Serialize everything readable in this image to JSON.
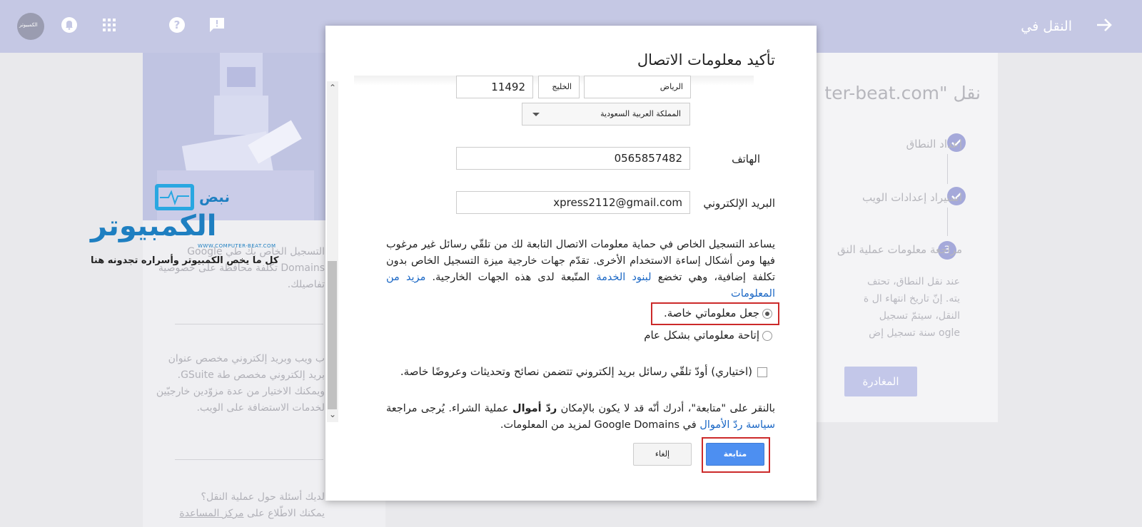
{
  "topbar": {
    "title": "النقل في",
    "avatar_text": "الكمبيوتر"
  },
  "background_left": {
    "text1": "التسجيل الخاص بك طي Google Domains تكلفة محافظة على خصوصية تفاصيلك.",
    "text2": "ب ويب وبريد إلكتروني مخصص عنوان بريد إلكتروني مخصص طة GSuite. ويمكنك الاختيار من عدة مزوّدين خارجيّين لخدمات الاستضافة على الويب.",
    "text3a": "لديك أسئلة حول عملية النقل؟",
    "text3b_prefix": "يمكنك الاطّلاع على",
    "text3b_link": "مركز المساعدة"
  },
  "background_right": {
    "title": "نقل \"ter-beat.com",
    "steps": [
      {
        "label": "إعداد النطاق"
      },
      {
        "label": "استيراد إعدادات الويب"
      },
      {
        "number": "3",
        "label": "مراجعة معلومات عملية النق"
      }
    ],
    "text": "عند نقل النطاق، تحتف يته. إنّ تاريخ انتهاء ال ة النقل، سيتمّ تسجيل ogle سنة تسجيل إض",
    "cancel_button": "المغادرة"
  },
  "watermark": {
    "nabd": "نبض",
    "name": "الكمبيوتر",
    "url": "WWW.COMPUTER-BEAT.COM",
    "subtitle": "كل ما يخص الكمبيوتر وأسراره تجدونه هنا"
  },
  "dialog": {
    "title": "تأكيد معلومات الاتصال",
    "city": "الرياض",
    "region": "الخليج",
    "postal": "11492",
    "country": "المملكة العربية السعودية",
    "phone_label": "الهاتف",
    "phone": "0565857482",
    "email_label": "البريد الإلكتروني",
    "email": "xpress2112@gmail.com",
    "privacy_text": "يساعد التسجيل الخاص في حماية معلومات الاتصال التابعة لك من تلقّي رسائل غير مرغوب فيها ومن أشكال إساءة الاستخدام الأخرى. تقدّم جهات خارجية ميزة التسجيل الخاص بدون تكلفة إضافية، وهي تخضع",
    "terms_link": "لبنود الخدمة",
    "privacy_text2": "المتّبعة لدى هذه الجهات الخارجية.",
    "learn_more": "مزيد من المعلومات",
    "radio_private": "جعل معلوماتي خاصة.",
    "radio_public": "إتاحة معلوماتي بشكل عام",
    "optin": "(اختياري) أودّ تلقّي رسائل بريد إلكتروني تتضمن نصائح وتحديثات وعروضًا خاصة.",
    "refund_text1": "بالنقر على \"متابعة\"، أدرك أنّه قد لا يكون بالإمكان",
    "refund_bold": "ردّ أموال",
    "refund_text2": "عملية الشراء. يُرجى مراجعة",
    "refund_link": "سياسة ردّ الأموال",
    "refund_text3": "في Google Domains لمزيد من المعلومات.",
    "continue_button": "متابعة",
    "cancel_button": "إلغاء"
  },
  "colors": {
    "topbar": "#c5c8e4",
    "primary_button": "#4d8ff1",
    "highlight_box": "#cc2a2a",
    "link": "#1a67c5"
  }
}
